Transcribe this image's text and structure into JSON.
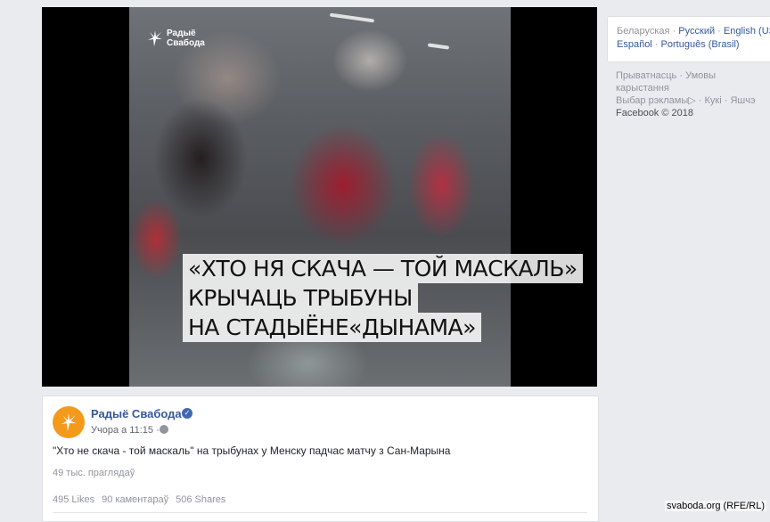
{
  "video": {
    "logo_text": "Радыё Свабода",
    "caption_lines": [
      "«ХТО НЯ СКАЧА — ТОЙ МАСКАЛЬ»",
      "КРЫЧАЦЬ ТРЫБУНЫ",
      "НА СТАДЫЁНЕ«ДЫНАМА»"
    ]
  },
  "post": {
    "page_name": "Радыё Свабода",
    "time": "Учора а 11:15 ·",
    "text": "\"Хто не скача - той маскаль\" на трыбунах у Менску падчас матчу з Сан-Марына",
    "views": "49 тыс. праглядаў",
    "likes": "495 Likes",
    "comments": "90 каментараў",
    "shares": "506 Shares"
  },
  "languages": {
    "row1": [
      "Беларуская",
      "Русский",
      "English (US)"
    ],
    "row2": [
      "Español",
      "Português (Brasil)"
    ],
    "separator": " · "
  },
  "footer": {
    "line1": [
      "Прыватнасць",
      "Умовы карыстання"
    ],
    "line2": [
      "Выбар рэкламы",
      "Кукі",
      "Яшчэ"
    ],
    "ad_choices_glyph": "▷",
    "copyright": "Facebook © 2018"
  },
  "watermark": "svaboda.org (RFE/RL)",
  "colors": {
    "link": "#365899",
    "brand_orange": "#f39a1b",
    "verified_blue": "#4267b2",
    "background": "#e9ebee"
  },
  "icons": [
    "rfe-logo-icon",
    "verified-icon",
    "globe-icon",
    "ad-choices-icon"
  ]
}
